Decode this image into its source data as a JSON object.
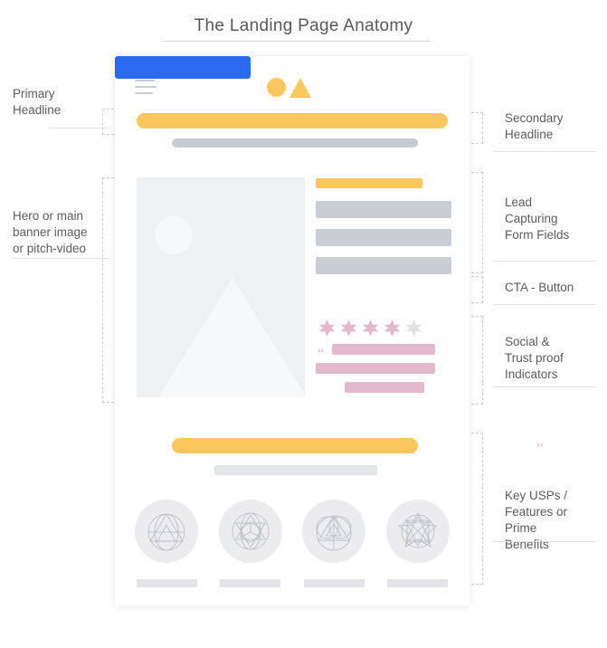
{
  "title": "The Landing Page Anatomy",
  "colors": {
    "accent_orange": "#FCC75E",
    "cta_blue": "#2A6AEE",
    "placeholder_gray": "#C9CDD4",
    "testimonial_pink": "#E4B9CC",
    "star_filled": "#E4B9CC",
    "star_empty": "#E0E0E2",
    "label_text": "#5b5c5e"
  },
  "annotations": {
    "left": [
      {
        "id": "primary-headline",
        "label": "Primary\nHeadline"
      },
      {
        "id": "hero-media",
        "label": "Hero or main\nbanner image\nor pitch-video"
      }
    ],
    "right": [
      {
        "id": "secondary-headline",
        "label": "Secondary\nHeadline"
      },
      {
        "id": "lead-form",
        "label": "Lead\nCapturing\nForm Fields"
      },
      {
        "id": "cta",
        "label": "CTA - Button"
      },
      {
        "id": "social-proof",
        "label": "Social &\nTrust proof\nIndicators"
      },
      {
        "id": "usps",
        "label": "Key USPs /\nFeatures or\nPrime\nBenefits"
      }
    ]
  },
  "mockup": {
    "header": {
      "menu_icon": "hamburger-icon",
      "logo_shapes": [
        "circle",
        "triangle"
      ]
    },
    "hero": {
      "image_placeholder_icons": [
        "sun-circle",
        "mountain-triangle"
      ]
    },
    "form": {
      "field_count": 3,
      "cta_present": true
    },
    "social_proof": {
      "stars_total": 5,
      "stars_filled": 4,
      "testimonial_lines": 3,
      "quote_open": "“",
      "quote_close": "”"
    },
    "features": {
      "count": 4,
      "icons": [
        "triangle-in-circle-icon",
        "cube-geometry-icon",
        "overlapping-circles-icon",
        "star-polygon-icon"
      ]
    }
  }
}
